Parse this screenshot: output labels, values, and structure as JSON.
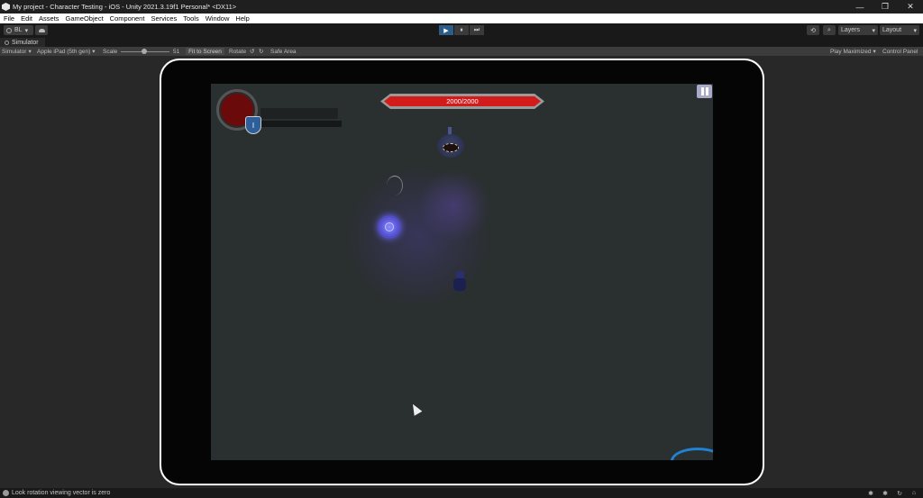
{
  "window": {
    "title": "My project - Character Testing - iOS - Unity 2021.3.19f1 Personal* <DX11>",
    "controls": {
      "minimize": "—",
      "restore": "❐",
      "close": "✕"
    }
  },
  "menu": {
    "items": [
      "File",
      "Edit",
      "Assets",
      "GameObject",
      "Component",
      "Services",
      "Tools",
      "Window",
      "Help"
    ]
  },
  "toolbar": {
    "account_label": "BL",
    "layers_label": "Layers",
    "layout_label": "Layout",
    "play_icon": "▶",
    "pause_icon": "⏸",
    "step_icon": "⏭",
    "history_icon": "⟲",
    "search_icon": "⌕",
    "dropdown_arrow": "▾"
  },
  "tab": {
    "label": "Simulator"
  },
  "sim_toolbar": {
    "mode_label": "Simulator",
    "device_label": "Apple iPad (5th gen)",
    "scale_label": "Scale",
    "scale_value": "51",
    "fit_label": "Fit to Screen",
    "rotate_label": "Rotate",
    "rotate_left_icon": "↺",
    "rotate_right_icon": "↻",
    "safe_area_label": "Safe Area",
    "play_mode_label": "Play Maximized",
    "control_panel_label": "Control Panel"
  },
  "game": {
    "boss_health": "2000/2000",
    "shield_glyph": "I"
  },
  "status": {
    "message": "Look rotation viewing vector is zero"
  }
}
